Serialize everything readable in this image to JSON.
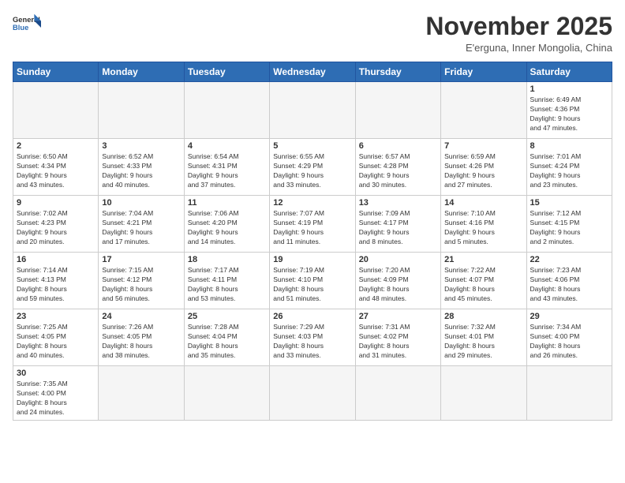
{
  "header": {
    "logo_general": "General",
    "logo_blue": "Blue",
    "month_title": "November 2025",
    "location": "E'erguna, Inner Mongolia, China"
  },
  "weekdays": [
    "Sunday",
    "Monday",
    "Tuesday",
    "Wednesday",
    "Thursday",
    "Friday",
    "Saturday"
  ],
  "weeks": [
    [
      {
        "day": "",
        "info": ""
      },
      {
        "day": "",
        "info": ""
      },
      {
        "day": "",
        "info": ""
      },
      {
        "day": "",
        "info": ""
      },
      {
        "day": "",
        "info": ""
      },
      {
        "day": "",
        "info": ""
      },
      {
        "day": "1",
        "info": "Sunrise: 6:49 AM\nSunset: 4:36 PM\nDaylight: 9 hours\nand 47 minutes."
      }
    ],
    [
      {
        "day": "2",
        "info": "Sunrise: 6:50 AM\nSunset: 4:34 PM\nDaylight: 9 hours\nand 43 minutes."
      },
      {
        "day": "3",
        "info": "Sunrise: 6:52 AM\nSunset: 4:33 PM\nDaylight: 9 hours\nand 40 minutes."
      },
      {
        "day": "4",
        "info": "Sunrise: 6:54 AM\nSunset: 4:31 PM\nDaylight: 9 hours\nand 37 minutes."
      },
      {
        "day": "5",
        "info": "Sunrise: 6:55 AM\nSunset: 4:29 PM\nDaylight: 9 hours\nand 33 minutes."
      },
      {
        "day": "6",
        "info": "Sunrise: 6:57 AM\nSunset: 4:28 PM\nDaylight: 9 hours\nand 30 minutes."
      },
      {
        "day": "7",
        "info": "Sunrise: 6:59 AM\nSunset: 4:26 PM\nDaylight: 9 hours\nand 27 minutes."
      },
      {
        "day": "8",
        "info": "Sunrise: 7:01 AM\nSunset: 4:24 PM\nDaylight: 9 hours\nand 23 minutes."
      }
    ],
    [
      {
        "day": "9",
        "info": "Sunrise: 7:02 AM\nSunset: 4:23 PM\nDaylight: 9 hours\nand 20 minutes."
      },
      {
        "day": "10",
        "info": "Sunrise: 7:04 AM\nSunset: 4:21 PM\nDaylight: 9 hours\nand 17 minutes."
      },
      {
        "day": "11",
        "info": "Sunrise: 7:06 AM\nSunset: 4:20 PM\nDaylight: 9 hours\nand 14 minutes."
      },
      {
        "day": "12",
        "info": "Sunrise: 7:07 AM\nSunset: 4:19 PM\nDaylight: 9 hours\nand 11 minutes."
      },
      {
        "day": "13",
        "info": "Sunrise: 7:09 AM\nSunset: 4:17 PM\nDaylight: 9 hours\nand 8 minutes."
      },
      {
        "day": "14",
        "info": "Sunrise: 7:10 AM\nSunset: 4:16 PM\nDaylight: 9 hours\nand 5 minutes."
      },
      {
        "day": "15",
        "info": "Sunrise: 7:12 AM\nSunset: 4:15 PM\nDaylight: 9 hours\nand 2 minutes."
      }
    ],
    [
      {
        "day": "16",
        "info": "Sunrise: 7:14 AM\nSunset: 4:13 PM\nDaylight: 8 hours\nand 59 minutes."
      },
      {
        "day": "17",
        "info": "Sunrise: 7:15 AM\nSunset: 4:12 PM\nDaylight: 8 hours\nand 56 minutes."
      },
      {
        "day": "18",
        "info": "Sunrise: 7:17 AM\nSunset: 4:11 PM\nDaylight: 8 hours\nand 53 minutes."
      },
      {
        "day": "19",
        "info": "Sunrise: 7:19 AM\nSunset: 4:10 PM\nDaylight: 8 hours\nand 51 minutes."
      },
      {
        "day": "20",
        "info": "Sunrise: 7:20 AM\nSunset: 4:09 PM\nDaylight: 8 hours\nand 48 minutes."
      },
      {
        "day": "21",
        "info": "Sunrise: 7:22 AM\nSunset: 4:07 PM\nDaylight: 8 hours\nand 45 minutes."
      },
      {
        "day": "22",
        "info": "Sunrise: 7:23 AM\nSunset: 4:06 PM\nDaylight: 8 hours\nand 43 minutes."
      }
    ],
    [
      {
        "day": "23",
        "info": "Sunrise: 7:25 AM\nSunset: 4:05 PM\nDaylight: 8 hours\nand 40 minutes."
      },
      {
        "day": "24",
        "info": "Sunrise: 7:26 AM\nSunset: 4:05 PM\nDaylight: 8 hours\nand 38 minutes."
      },
      {
        "day": "25",
        "info": "Sunrise: 7:28 AM\nSunset: 4:04 PM\nDaylight: 8 hours\nand 35 minutes."
      },
      {
        "day": "26",
        "info": "Sunrise: 7:29 AM\nSunset: 4:03 PM\nDaylight: 8 hours\nand 33 minutes."
      },
      {
        "day": "27",
        "info": "Sunrise: 7:31 AM\nSunset: 4:02 PM\nDaylight: 8 hours\nand 31 minutes."
      },
      {
        "day": "28",
        "info": "Sunrise: 7:32 AM\nSunset: 4:01 PM\nDaylight: 8 hours\nand 29 minutes."
      },
      {
        "day": "29",
        "info": "Sunrise: 7:34 AM\nSunset: 4:00 PM\nDaylight: 8 hours\nand 26 minutes."
      }
    ],
    [
      {
        "day": "30",
        "info": "Sunrise: 7:35 AM\nSunset: 4:00 PM\nDaylight: 8 hours\nand 24 minutes."
      },
      {
        "day": "",
        "info": ""
      },
      {
        "day": "",
        "info": ""
      },
      {
        "day": "",
        "info": ""
      },
      {
        "day": "",
        "info": ""
      },
      {
        "day": "",
        "info": ""
      },
      {
        "day": "",
        "info": ""
      }
    ]
  ]
}
